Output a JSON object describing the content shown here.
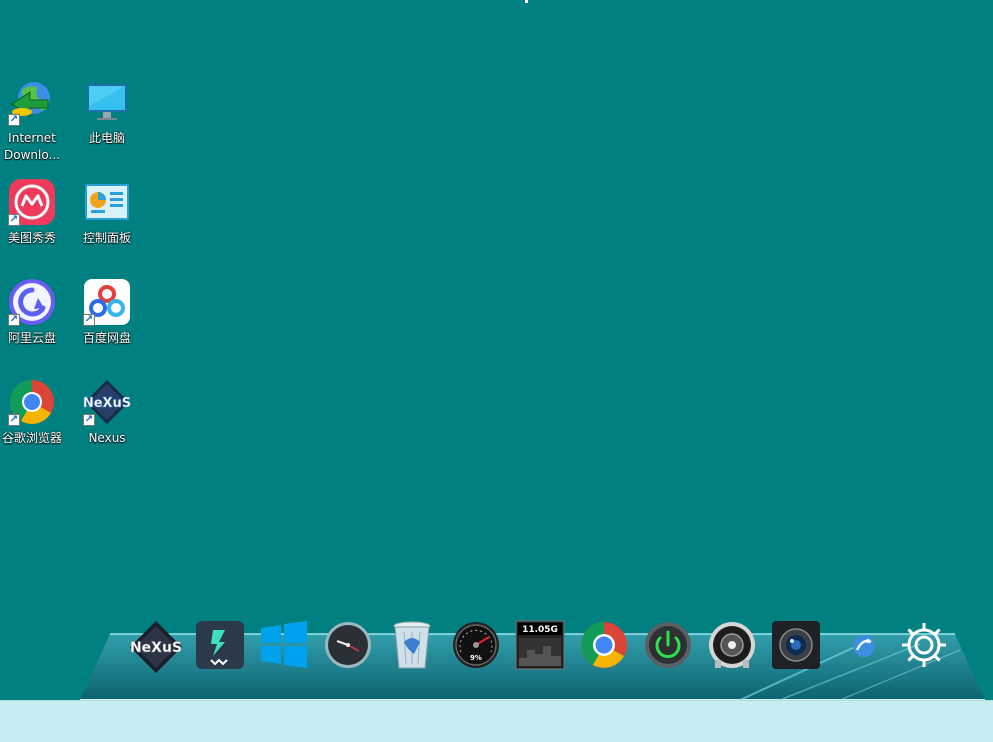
{
  "desktop": {
    "background": "#008080",
    "icons": [
      {
        "label": "Internet Downlo...",
        "icon": "idm-globe-icon",
        "shortcut": true
      },
      {
        "label": "此电脑",
        "icon": "monitor-icon",
        "shortcut": false
      },
      {
        "label": "美图秀秀",
        "icon": "meitu-icon",
        "shortcut": true
      },
      {
        "label": "控制面板",
        "icon": "control-panel-icon",
        "shortcut": false
      },
      {
        "label": "阿里云盘",
        "icon": "aliyun-drive-icon",
        "shortcut": true
      },
      {
        "label": "百度网盘",
        "icon": "baidu-netdisk-icon",
        "shortcut": true
      },
      {
        "label": "谷歌浏览器",
        "icon": "chrome-icon",
        "shortcut": true
      },
      {
        "label": "Nexus",
        "icon": "nexus-icon",
        "shortcut": true
      }
    ]
  },
  "dock": {
    "items": [
      {
        "icon": "nexus-logo-icon",
        "text": "NeXuS"
      },
      {
        "icon": "filmora-icon"
      },
      {
        "icon": "windows-icon"
      },
      {
        "icon": "clock-icon"
      },
      {
        "icon": "recycle-bin-icon"
      },
      {
        "icon": "cpu-gauge-icon",
        "text": "9%"
      },
      {
        "icon": "disk-meter-icon",
        "text": "11.05G"
      },
      {
        "icon": "chrome-icon"
      },
      {
        "icon": "power-icon"
      },
      {
        "icon": "speaker-icon"
      },
      {
        "icon": "camera-icon"
      },
      {
        "icon": "app-orb-icon"
      },
      {
        "icon": "gear-icon"
      }
    ]
  },
  "colors": {
    "taskbar": "#c6eef0",
    "accent_blue": "#00a2ed"
  }
}
